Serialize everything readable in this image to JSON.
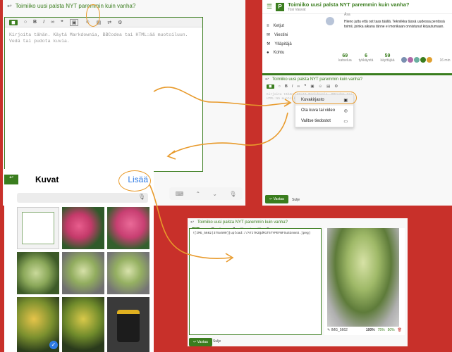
{
  "composer": {
    "title": "Toimiiko uusi palsta NYT paremmin kuin vanha?",
    "placeholder": "Kirjoita tähän. Käytä Markdownia, BBCodea tai HTML:ää muotoiluun. Vedä tai pudota kuvia.",
    "reply_button": "Vastaa",
    "cancel": "Sulje",
    "toolbar_code": "◼"
  },
  "photos_sheet": {
    "title": "Kuvat",
    "add": "Lisää"
  },
  "forum": {
    "logo_letter": "P",
    "topic_title": "Toimiiko uusi palsta NYT paremmin kuin vanha?",
    "category": "Tosi Vauvat",
    "author": "Åsa",
    "post_text": "Hieno juttu että ost taas täällä. Tekniikka tässä uudessa pentissä toimii, joinka aikana tänne ei monikaan onnistunut kirjautumaan.",
    "sidebar": [
      "Ketjut",
      "Viestini",
      "Ylläpitäjä",
      "Kohtu"
    ],
    "stats": [
      {
        "value": "69",
        "label": "katselua"
      },
      {
        "value": "6",
        "label": "tykkäystä"
      },
      {
        "value": "59",
        "label": "käyttäjää"
      }
    ],
    "time": "16 min"
  },
  "upload_menu": {
    "items": [
      {
        "label": "Kuvakirjasto",
        "icon": "photo-library-icon"
      },
      {
        "label": "Ota kuva tai video",
        "icon": "camera-icon"
      },
      {
        "label": "Valitse tiedostot",
        "icon": "folder-icon"
      }
    ]
  },
  "result": {
    "markdown": "![IMG_5662|375x500](upload://A7J7K2QdM1T5TYPEFNFSuS3nmnS.jpeg)",
    "image_name": "IMG_5662",
    "zoom_options": [
      "100%",
      "75%",
      "50%"
    ]
  },
  "colors": {
    "brand_green": "#3a7d1e",
    "annotation_orange": "#e89a2b",
    "ios_blue": "#2f7be5",
    "background_red": "#c8302a"
  }
}
